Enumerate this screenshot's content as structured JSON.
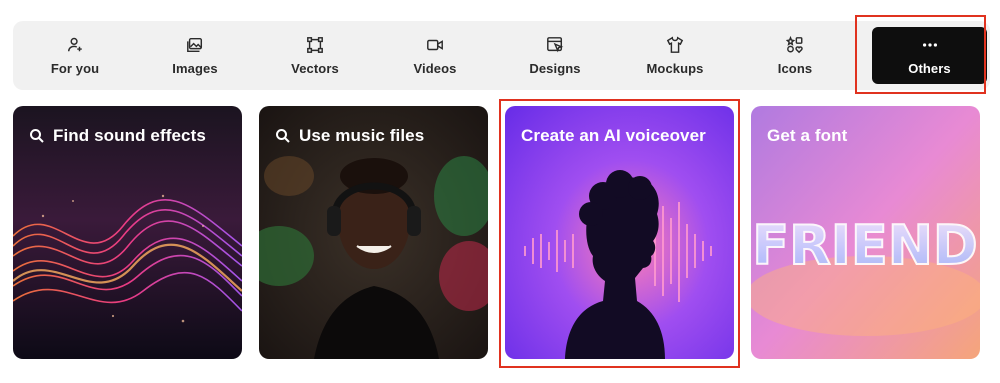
{
  "tabs": [
    {
      "label": "For you",
      "icon": "user-plus-icon"
    },
    {
      "label": "Images",
      "icon": "image-icon"
    },
    {
      "label": "Vectors",
      "icon": "vector-nodes-icon"
    },
    {
      "label": "Videos",
      "icon": "video-camera-icon"
    },
    {
      "label": "Designs",
      "icon": "design-cursor-icon"
    },
    {
      "label": "Mockups",
      "icon": "tshirt-icon"
    },
    {
      "label": "Icons",
      "icon": "shapes-icon"
    },
    {
      "label": "Others",
      "icon": "more-dots-icon",
      "active": true
    }
  ],
  "cards": [
    {
      "title": "Find sound effects",
      "icon": "search-icon"
    },
    {
      "title": "Use music files",
      "icon": "search-icon"
    },
    {
      "title": "Create an AI voiceover"
    },
    {
      "title": "Get a font",
      "font_sample": "FRIEND"
    }
  ],
  "colors": {
    "active_tab": "#0e0e0e",
    "highlight": "#e0321f",
    "tabbar": "#f1f1f1"
  }
}
